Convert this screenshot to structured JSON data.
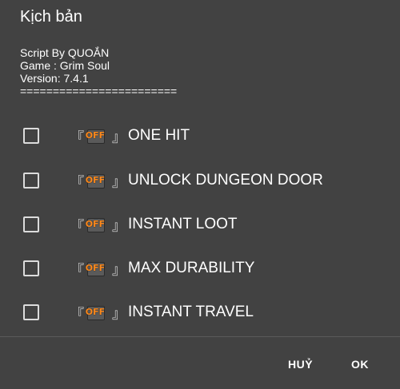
{
  "dialog": {
    "title": "Kịch bản",
    "info_lines": [
      "Script By QUOẮN",
      "Game : Grim Soul",
      "Version: 7.4.1",
      "========================"
    ],
    "options": [
      {
        "label": "ONE HIT",
        "checked": false,
        "badge": "OFF",
        "bracket_open": "『",
        "bracket_close": "』"
      },
      {
        "label": "UNLOCK DUNGEON DOOR",
        "checked": false,
        "badge": "OFF",
        "bracket_open": "『",
        "bracket_close": "』"
      },
      {
        "label": "INSTANT LOOT",
        "checked": false,
        "badge": "OFF",
        "bracket_open": "『",
        "bracket_close": "』"
      },
      {
        "label": "MAX DURABILITY",
        "checked": false,
        "badge": "OFF",
        "bracket_open": "『",
        "bracket_close": "』"
      },
      {
        "label": "INSTANT TRAVEL",
        "checked": false,
        "badge": "OFF",
        "bracket_open": "『",
        "bracket_close": "』"
      }
    ],
    "buttons": {
      "cancel_label": "HUỶ",
      "ok_label": "OK"
    }
  },
  "colors": {
    "background": "#424242",
    "text": "#ffffff",
    "off_badge": "#ff8a1c",
    "checkbox_border": "#dcdcdc"
  },
  "icons": {
    "checkbox": "checkbox-unchecked-icon",
    "badge": "off-toggle-icon"
  }
}
